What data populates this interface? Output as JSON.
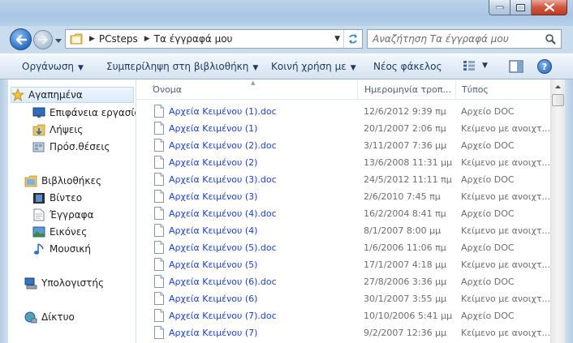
{
  "address": {
    "crumbs": [
      "PCsteps",
      "Τα έγγραφά μου"
    ]
  },
  "search": {
    "placeholder": "Αναζήτηση Τα έγγραφά μου"
  },
  "toolbar": {
    "organize": "Οργάνωση",
    "include": "Συμπερίληψη στη βιβλιοθήκη",
    "share": "Κοινή χρήση με",
    "new_folder": "Νέος φάκελος",
    "help": "?"
  },
  "sidebar": {
    "favorites": {
      "label": "Αγαπημένα",
      "items": [
        "Επιφάνεια εργασίας",
        "Λήψεις",
        "Πρόσ.θέσεις"
      ]
    },
    "libraries": {
      "label": "Βιβλιοθήκες",
      "items": [
        "Βίντεο",
        "Έγγραφα",
        "Εικόνες",
        "Μουσική"
      ]
    },
    "computer": "Υπολογιστής",
    "network": "Δίκτυο"
  },
  "columns": {
    "name": "Όνομα",
    "date": "Ημερομηνία τροπ...",
    "type": "Τύπος"
  },
  "files": [
    {
      "name": "Αρχεία Κειμένου (1).doc",
      "date": "12/6/2012 9:39 πμ",
      "type": "Αρχείο DOC"
    },
    {
      "name": "Αρχεία Κειμένου (1)",
      "date": "20/1/2007 2:06 πμ",
      "type": "Κείμενο με ανοιχτ..."
    },
    {
      "name": "Αρχεία Κειμένου (2).doc",
      "date": "3/11/2007 7:36 μμ",
      "type": "Αρχείο DOC"
    },
    {
      "name": "Αρχεία Κειμένου (2)",
      "date": "13/6/2008 11:31 μμ",
      "type": "Κείμενο με ανοιχτ..."
    },
    {
      "name": "Αρχεία Κειμένου (3).doc",
      "date": "24/5/2012 11:11 πμ",
      "type": "Αρχείο DOC"
    },
    {
      "name": "Αρχεία Κειμένου (3)",
      "date": "2/6/2010 7:45 πμ",
      "type": "Κείμενο με ανοιχτ..."
    },
    {
      "name": "Αρχεία Κειμένου (4).doc",
      "date": "16/2/2004 8:41 πμ",
      "type": "Αρχείο DOC"
    },
    {
      "name": "Αρχεία Κειμένου (4)",
      "date": "8/1/2007 8:00 μμ",
      "type": "Κείμενο με ανοιχτ..."
    },
    {
      "name": "Αρχεία Κειμένου (5).doc",
      "date": "1/6/2006 11:06 πμ",
      "type": "Αρχείο DOC"
    },
    {
      "name": "Αρχεία Κειμένου (5)",
      "date": "17/1/2007 4:18 μμ",
      "type": "Κείμενο με ανοιχτ..."
    },
    {
      "name": "Αρχεία Κειμένου (6).doc",
      "date": "27/8/2006 3:36 μμ",
      "type": "Αρχείο DOC"
    },
    {
      "name": "Αρχεία Κειμένου (6)",
      "date": "30/1/2007 3:55 μμ",
      "type": "Κείμενο με ανοιχτ..."
    },
    {
      "name": "Αρχεία Κειμένου (7).doc",
      "date": "10/10/2006 5:41 μμ",
      "type": "Αρχείο DOC"
    },
    {
      "name": "Αρχεία Κειμένου (7)",
      "date": "9/2/2007 12:36 μμ",
      "type": "Κείμενο με ανοιχτ..."
    }
  ]
}
